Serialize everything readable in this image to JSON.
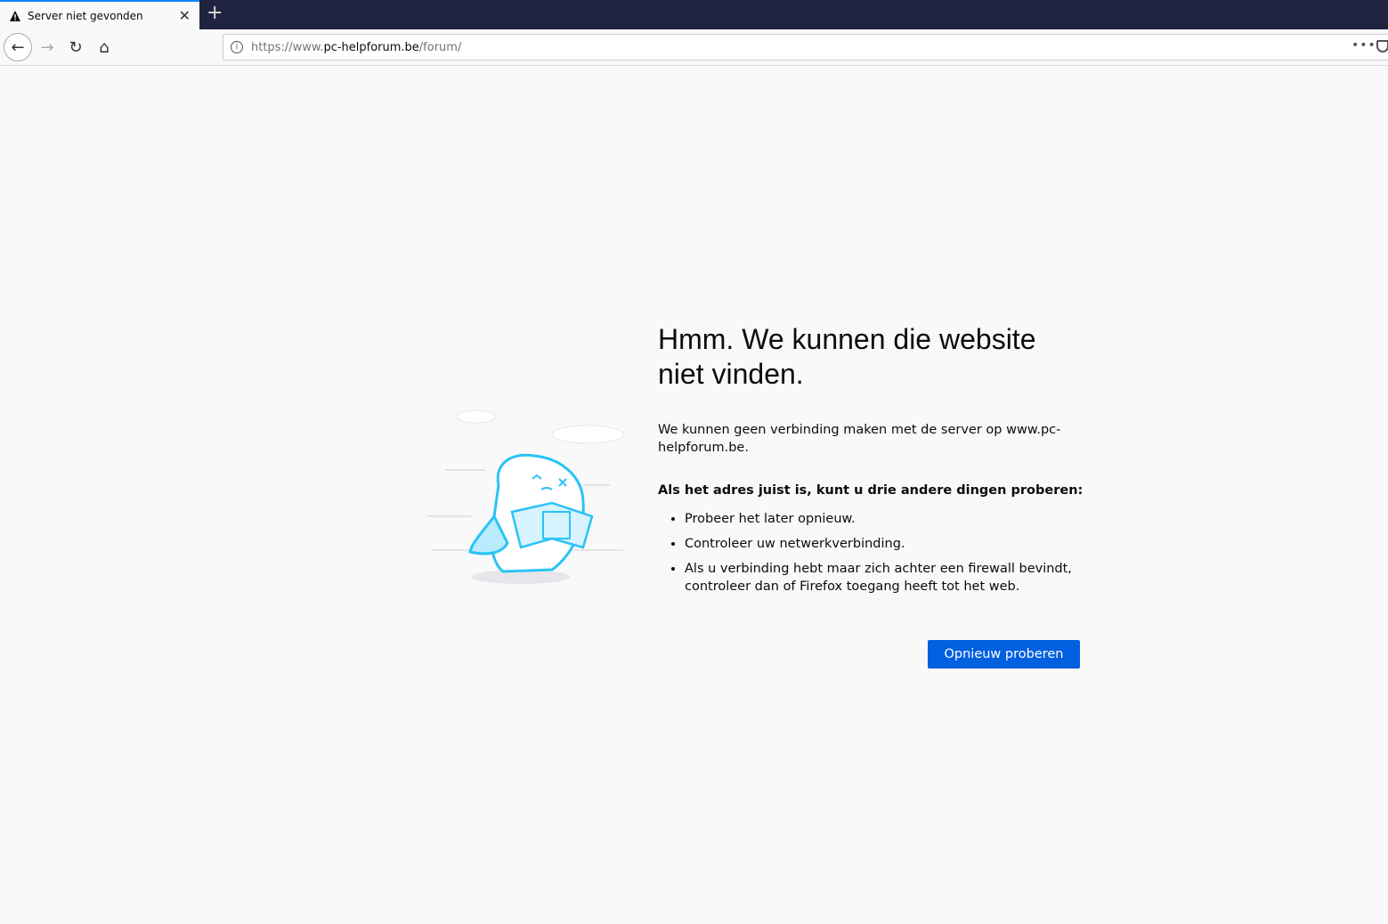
{
  "tab": {
    "title": "Server niet gevonden",
    "icon": "warning-icon"
  },
  "url": {
    "prefix": "https://www.",
    "domain": "pc-helpforum.be",
    "path": "/forum/"
  },
  "error": {
    "title": "Hmm. We kunnen die website niet vinden.",
    "description": "We kunnen geen verbinding maken met de server op www.pc-helpforum.be.",
    "subtitle": "Als het adres juist is, kunt u drie andere dingen proberen:",
    "suggestions": [
      "Probeer het later opnieuw.",
      "Controleer uw netwerkverbinding.",
      "Als u verbinding hebt maar zich achter een firewall bevindt, controleer dan of Firefox toegang heeft tot het web."
    ],
    "retry_label": "Opnieuw proberen"
  },
  "colors": {
    "accent": "#0060df",
    "tab_highlight": "#0a84ff",
    "tabbar": "#202340"
  }
}
